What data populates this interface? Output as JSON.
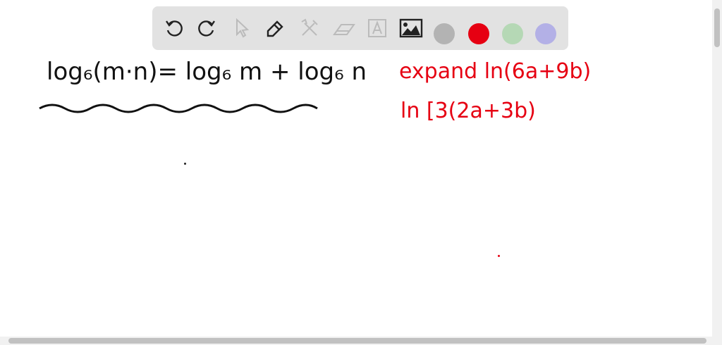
{
  "toolbar": {
    "tools": [
      "undo-icon",
      "redo-icon",
      "select-icon",
      "pen-icon",
      "tools-icon",
      "eraser-icon",
      "text-icon",
      "image-icon"
    ],
    "colors": {
      "gray": "#b3b3b3",
      "red": "#e60012",
      "green": "#b5d8b5",
      "purple": "#b3b0e6"
    }
  },
  "canvas": {
    "formula": "log₆(m·n)= log₆ m + log₆ n",
    "note_line1": "expand ln(6a+9b)",
    "note_line2": "ln [3(2a+3b)"
  }
}
